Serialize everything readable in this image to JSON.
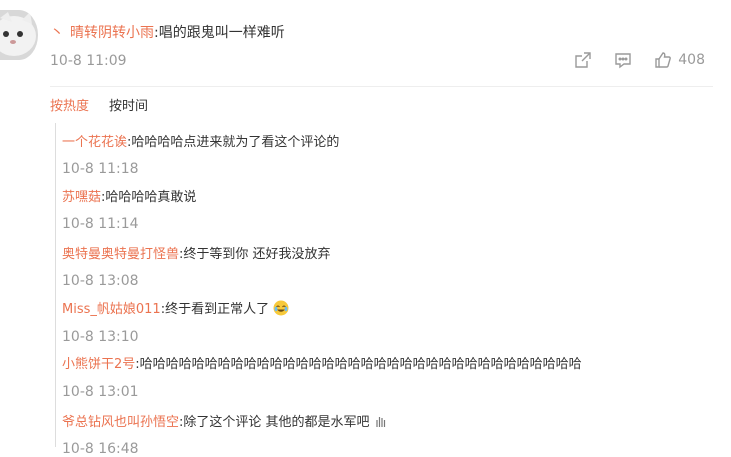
{
  "top_comment": {
    "user": "晴转阴转小雨",
    "text": ":唱的跟鬼叫一样难听",
    "time": "10-8 11:09",
    "like_count": "408"
  },
  "sort": {
    "hot": "按热度",
    "time": "按时间"
  },
  "replies": [
    {
      "user": "一个花花诶",
      "text": ":哈哈哈哈点进来就为了看这个评论的",
      "time": "10-8 11:18"
    },
    {
      "user": "苏嘿菇",
      "text": ":哈哈哈哈真敢说",
      "time": "10-8 11:14"
    },
    {
      "user": "奥特曼奥特曼打怪兽",
      "text": ":终于等到你 还好我没放弃",
      "time": "10-8 13:08"
    },
    {
      "user": "Miss_帆姑娘011",
      "text": ":终于看到正常人了",
      "time": "10-8 13:10"
    },
    {
      "user": "小熊饼干2号",
      "text": ":哈哈哈哈哈哈哈哈哈哈哈哈哈哈哈哈哈哈哈哈哈哈哈哈哈哈哈哈哈哈哈哈哈哈",
      "time": "10-8 13:01"
    },
    {
      "user": "爷总钻风也叫孙悟空",
      "text": ":除了这个评论 其他的都是水军吧",
      "time": "10-8 16:48"
    }
  ],
  "colors": {
    "accent": "#eb7350",
    "muted": "#9a9a9a"
  },
  "icons": [
    "share-icon",
    "comment-icon",
    "like-icon",
    "laugh-cry-emoji",
    "waving-hand-emoji"
  ]
}
